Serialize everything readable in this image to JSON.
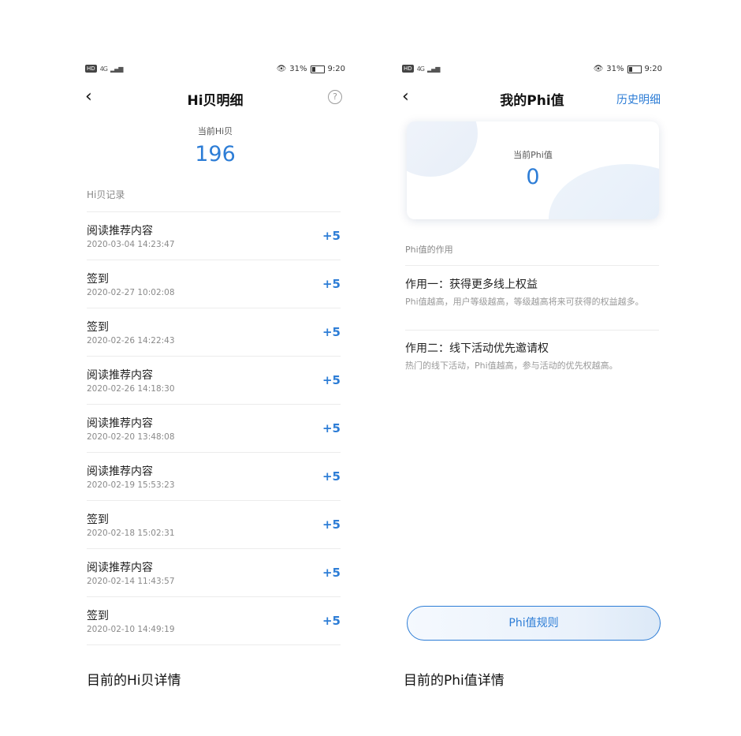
{
  "status_bar": {
    "network": "HD",
    "signal": "4G",
    "battery_percent": "31%",
    "battery_level": 0.31,
    "time": "9:20",
    "eye_icon": "eye-icon"
  },
  "hi_screen": {
    "back_icon": "chevron-left-icon",
    "title": "Hi贝明细",
    "help_icon": "question-circle-icon",
    "current_label": "当前Hi贝",
    "current_value": "196",
    "records_title": "Hi贝记录",
    "records": [
      {
        "title": "阅读推荐内容",
        "time": "2020-03-04 14:23:47",
        "amount": "+5"
      },
      {
        "title": "签到",
        "time": "2020-02-27 10:02:08",
        "amount": "+5"
      },
      {
        "title": "签到",
        "time": "2020-02-26 14:22:43",
        "amount": "+5"
      },
      {
        "title": "阅读推荐内容",
        "time": "2020-02-26 14:18:30",
        "amount": "+5"
      },
      {
        "title": "阅读推荐内容",
        "time": "2020-02-20 13:48:08",
        "amount": "+5"
      },
      {
        "title": "阅读推荐内容",
        "time": "2020-02-19 15:53:23",
        "amount": "+5"
      },
      {
        "title": "签到",
        "time": "2020-02-18 15:02:31",
        "amount": "+5"
      },
      {
        "title": "阅读推荐内容",
        "time": "2020-02-14 11:43:57",
        "amount": "+5"
      },
      {
        "title": "签到",
        "time": "2020-02-10 14:49:19",
        "amount": "+5"
      }
    ],
    "caption": "目前的Hi贝详情"
  },
  "phi_screen": {
    "back_icon": "chevron-left-icon",
    "title": "我的Phi值",
    "history_link": "历史明细",
    "card_label": "当前Phi值",
    "card_value": "0",
    "section_title": "Phi值的作用",
    "uses": [
      {
        "title": "作用一：获得更多线上权益",
        "desc": "Phi值越高，用户等级越高，等级越高将来可获得的权益越多。"
      },
      {
        "title": "作用二：线下活动优先邀请权",
        "desc": "热门的线下活动，Phi值越高，参与活动的优先权越高。"
      }
    ],
    "rules_button": "Phi值规则",
    "caption": "目前的Phi值详情"
  },
  "colors": {
    "accent": "#2d7dd6",
    "text": "#222222",
    "muted": "#888888",
    "divider": "#ececec"
  }
}
